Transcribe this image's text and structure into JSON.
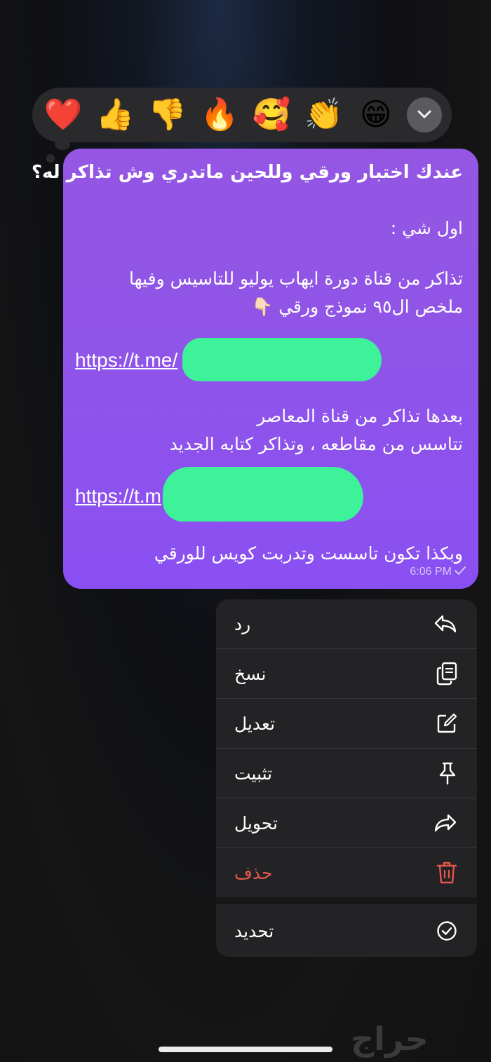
{
  "reactions": [
    "❤️",
    "👍",
    "👎",
    "🔥",
    "🥰",
    "👏",
    "😁"
  ],
  "message": {
    "title": "عندك اختبار ورقي وللحين ماتدري وش تذاكر له؟",
    "line1": "اول شي :",
    "line2": "تذاكر من قناة دورة ايهاب يوليو للتاسيس وفيها",
    "line3": "ملخص ال٩٥ نموذج ورقي 👇🏻",
    "link1": "https://t.me/",
    "line4": "بعدها تذاكر من قناة المعاصر",
    "line5": "تتاسس من مقاطعه ، وتذاكر كتابه الجديد",
    "link2": "https://t.m",
    "line6": "وبكذا تكون تاسست وتدربت كويس للورقي",
    "time": "6:06 PM"
  },
  "menu": {
    "reply": "رد",
    "copy": "نسخ",
    "edit": "تعديل",
    "pin": "تثبيت",
    "forward": "تحويل",
    "delete": "حذف",
    "select": "تحديد"
  },
  "colors": {
    "bubble": "#8f55e8",
    "danger": "#e8564b",
    "redaction": "#3ef29a"
  },
  "watermark": "حراج"
}
